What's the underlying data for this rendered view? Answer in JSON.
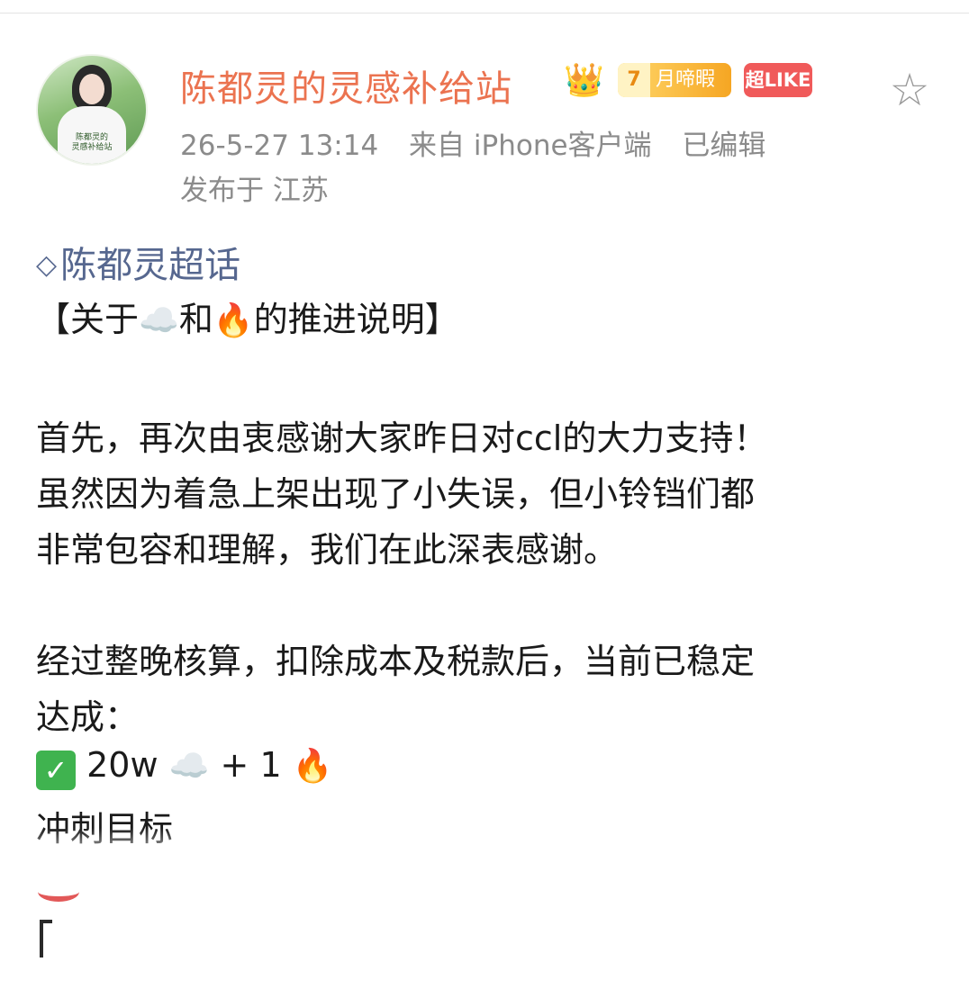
{
  "post": {
    "username": "陈都灵的灵感补给站",
    "crown_emoji": "👑",
    "badge_month_level": "7",
    "badge_month_text": "月啼暇",
    "badge_like": "超LIKE",
    "timestamp": "26-5-27 13:14",
    "source": "来自 iPhone客户端",
    "edited": "已编辑",
    "location": "发布于 江苏",
    "avatar_caption": "陈都灵的\n灵感补给站",
    "star_glyph": "☆"
  },
  "content": {
    "topic": "陈都灵超话",
    "title_open": "【关于",
    "cloud_emoji": "☁️",
    "title_and": "和",
    "fire_emoji": "🔥",
    "title_close": "的推进说明】",
    "para1_line1": "首先，再次由衷感谢大家昨日对ccl的大力支持！",
    "para1_line2": "虽然因为着急上架出现了小失误，但小铃铛们都",
    "para1_line3": "非常包容和理解，我们在此深表感谢。",
    "para2_line1": "经过整晚核算，扣除成本及税款后，当前已稳定",
    "para2_line2": "达成：",
    "achieve_check": "✓",
    "achieve_amount": "20w",
    "achieve_plus": "+ 1",
    "goal_prefix": "冲刺目标"
  },
  "colors": {
    "username": "#eb7350",
    "topic": "#56678f",
    "meta": "#8b8b8b",
    "like_badge": "#f05a5a"
  },
  "icons": [
    "crown-icon",
    "star-favorite-icon",
    "diamond-topic-icon",
    "cloud-icon",
    "fire-icon",
    "check-icon"
  ]
}
